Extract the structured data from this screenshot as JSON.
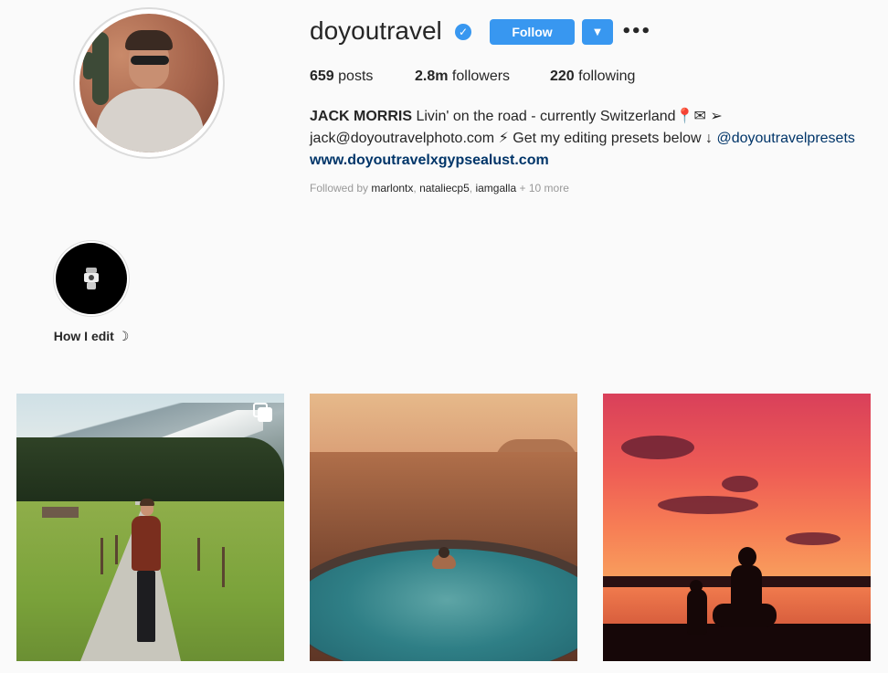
{
  "profile": {
    "username": "doyoutravel",
    "verified_glyph": "✓",
    "follow_label": "Follow",
    "dropdown_glyph": "▼",
    "more_glyph": "•••",
    "stats": {
      "posts_count": "659",
      "posts_label": "posts",
      "followers_count": "2.8m",
      "followers_label": "followers",
      "following_count": "220",
      "following_label": "following"
    },
    "bio": {
      "name": "JACK MORRIS",
      "line1_text": "Livin' on the road - currently Switzerland📍✉ ➢",
      "email": "jack@doyoutravelphoto.com",
      "line2_text": " ⚡ Get my editing presets below ↓ ",
      "mention": "@doyoutravelpresets",
      "website": "www.doyoutravelxgypsealust.com"
    },
    "followed_by": {
      "prefix": "Followed by",
      "users": [
        "marlontx",
        "nataliecp5",
        "iamgalla"
      ],
      "suffix": "+ 10 more"
    }
  },
  "highlights": [
    {
      "label": "How I edit ☽"
    }
  ],
  "colors": {
    "accent": "#3897f0",
    "text": "#262626",
    "muted": "#999999",
    "link": "#003569",
    "background": "#fafafa"
  },
  "icons": {
    "verified": "verified-badge-icon",
    "dropdown": "chevron-down-icon",
    "more": "more-options-icon",
    "multi_post": "multiple-photos-icon",
    "highlight_cover": "camera-icon"
  }
}
